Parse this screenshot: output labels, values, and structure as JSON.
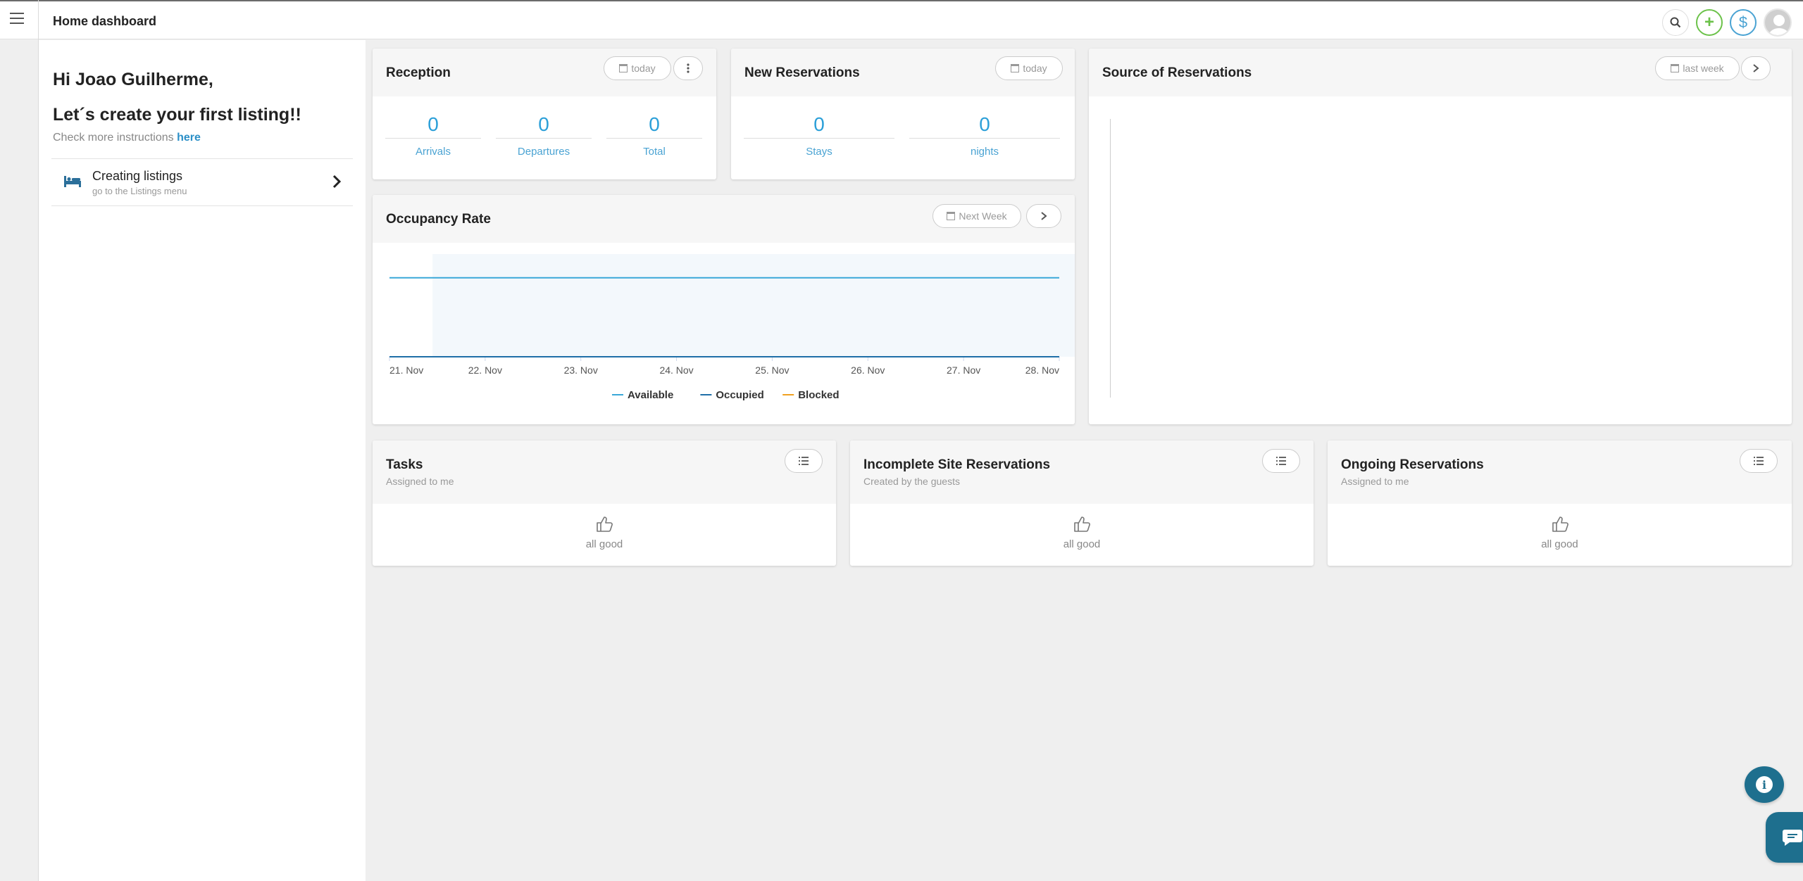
{
  "header": {
    "title": "Home dashboard"
  },
  "welcome": {
    "greeting": "Hi Joao Guilherme,",
    "headline": "Let´s create your first listing!!",
    "instructions_prefix": "Check more instructions ",
    "instructions_link": "here",
    "item_title": "Creating listings",
    "item_subtitle": "go to the Listings menu"
  },
  "reception": {
    "title": "Reception",
    "period": "today",
    "stats": [
      {
        "value": "0",
        "label": "Arrivals"
      },
      {
        "value": "0",
        "label": "Departures"
      },
      {
        "value": "0",
        "label": "Total"
      }
    ]
  },
  "new_reservations": {
    "title": "New Reservations",
    "period": "today",
    "stats": [
      {
        "value": "0",
        "label": "Stays"
      },
      {
        "value": "0",
        "label": "nights"
      }
    ]
  },
  "source": {
    "title": "Source of Reservations",
    "period": "last week"
  },
  "occupancy": {
    "title": "Occupancy Rate",
    "period": "Next Week"
  },
  "chart_data": {
    "type": "line",
    "categories": [
      "21. Nov",
      "22. Nov",
      "23. Nov",
      "24. Nov",
      "25. Nov",
      "26. Nov",
      "27. Nov",
      "28. Nov"
    ],
    "series": [
      {
        "name": "Available",
        "values": [
          1,
          1,
          1,
          1,
          1,
          1,
          1,
          1
        ],
        "color": "#3aa8d8"
      },
      {
        "name": "Occupied",
        "values": [
          0,
          0,
          0,
          0,
          0,
          0,
          0,
          0
        ],
        "color": "#1f6fa8"
      },
      {
        "name": "Blocked",
        "values": [
          0,
          0,
          0,
          0,
          0,
          0,
          0,
          0
        ],
        "color": "#f0a020"
      }
    ],
    "ylim": [
      0,
      1.3
    ],
    "highlight_range": [
      0.45,
      7.2
    ],
    "legend": "bottom-center",
    "grid": false
  },
  "tasks": {
    "title": "Tasks",
    "subtitle": "Assigned to me",
    "empty": "all good"
  },
  "incomplete": {
    "title": "Incomplete Site Reservations",
    "subtitle": "Created by the guests",
    "empty": "all good"
  },
  "ongoing": {
    "title": "Ongoing Reservations",
    "subtitle": "Assigned to me",
    "empty": "all good"
  },
  "colors": {
    "accent": "#2b9fd8",
    "green": "#6cc24a",
    "fab": "#1e6f8e"
  }
}
